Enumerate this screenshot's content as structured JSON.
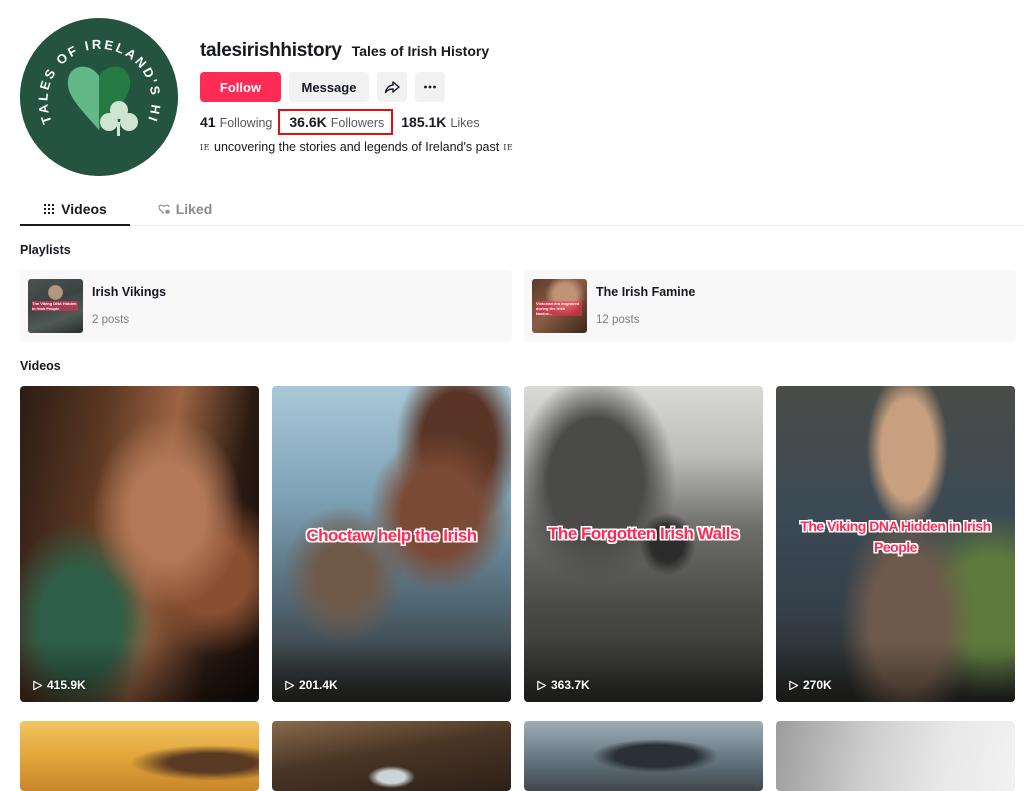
{
  "profile": {
    "username": "talesirishhistory",
    "nickname": "Tales of Irish History",
    "avatar_text": "TALES OF IRELAND'S HISTORY",
    "bio_flag": "IE",
    "bio": "uncovering the stories and legends of Ireland's past",
    "buttons": {
      "follow": "Follow",
      "message": "Message",
      "share_icon": "share-icon",
      "more_icon": "more-icon"
    },
    "stats": {
      "following_count": "41",
      "following_label": "Following",
      "followers_count": "36.6K",
      "followers_label": "Followers",
      "likes_count": "185.1K",
      "likes_label": "Likes"
    }
  },
  "tabs": [
    {
      "label": "Videos",
      "icon": "grid-icon",
      "active": true
    },
    {
      "label": "Liked",
      "icon": "heart-lock-icon",
      "active": false
    }
  ],
  "playlists": {
    "title": "Playlists",
    "items": [
      {
        "name": "Irish Vikings",
        "count": "2 posts",
        "thumb_caption": "The Viking DNA Hidden in Irish People"
      },
      {
        "name": "The Irish Famine",
        "count": "12 posts",
        "thumb_caption": "Victorian era engraved during the Irish famine..."
      }
    ]
  },
  "videos": {
    "title": "Videos",
    "items": [
      {
        "caption": "",
        "views": "415.9K"
      },
      {
        "caption": "Choctaw help the Irish",
        "views": "201.4K"
      },
      {
        "caption": "The Forgotten Irish Walls",
        "views": "363.7K"
      },
      {
        "caption": "The Viking DNA Hidden in Irish People",
        "views": "270K"
      },
      {
        "caption": "",
        "views": ""
      },
      {
        "caption": "",
        "views": ""
      },
      {
        "caption": "",
        "views": ""
      },
      {
        "caption": "",
        "views": ""
      }
    ]
  },
  "colors": {
    "accent": "#fe2c55",
    "highlight_box": "#e01010",
    "avatar_bg": "#24543f"
  }
}
